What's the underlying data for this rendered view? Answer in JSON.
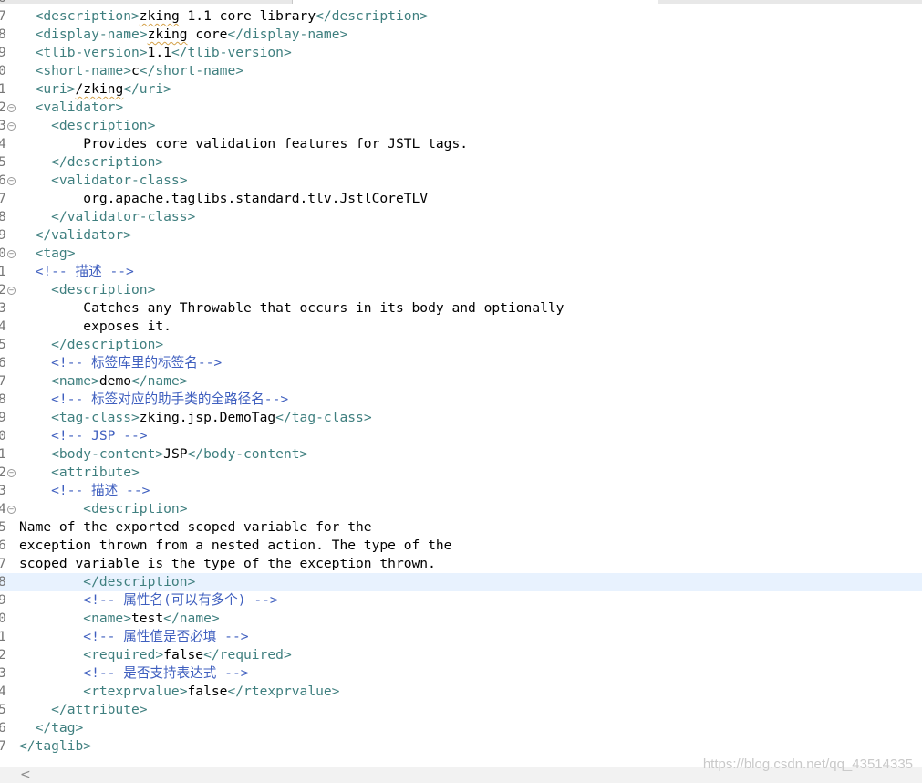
{
  "editor": {
    "current_line": 32,
    "lines": [
      {
        "num": "6",
        "fold": false,
        "segs": []
      },
      {
        "num": "7",
        "fold": false,
        "segs": [
          {
            "t": "  <description>",
            "c": "tag"
          },
          {
            "t": "zking",
            "c": "txt",
            "sq": true
          },
          {
            "t": " 1.1 core library",
            "c": "txt"
          },
          {
            "t": "</description>",
            "c": "tag"
          }
        ]
      },
      {
        "num": "8",
        "fold": false,
        "segs": [
          {
            "t": "  <display-name>",
            "c": "tag"
          },
          {
            "t": "zking",
            "c": "txt",
            "sq": true
          },
          {
            "t": " core",
            "c": "txt"
          },
          {
            "t": "</display-name>",
            "c": "tag"
          }
        ]
      },
      {
        "num": "9",
        "fold": false,
        "segs": [
          {
            "t": "  <tlib-version>",
            "c": "tag"
          },
          {
            "t": "1.1",
            "c": "txt"
          },
          {
            "t": "</tlib-version>",
            "c": "tag"
          }
        ]
      },
      {
        "num": "0",
        "fold": false,
        "segs": [
          {
            "t": "  <short-name>",
            "c": "tag"
          },
          {
            "t": "c",
            "c": "txt"
          },
          {
            "t": "</short-name>",
            "c": "tag"
          }
        ]
      },
      {
        "num": "1",
        "fold": false,
        "segs": [
          {
            "t": "  <uri>",
            "c": "tag"
          },
          {
            "t": "/zking",
            "c": "txt",
            "sq": true
          },
          {
            "t": "</uri>",
            "c": "tag"
          }
        ]
      },
      {
        "num": "2",
        "fold": true,
        "segs": [
          {
            "t": "  <validator>",
            "c": "tag"
          }
        ]
      },
      {
        "num": "3",
        "fold": true,
        "segs": [
          {
            "t": "    <description>",
            "c": "tag"
          }
        ]
      },
      {
        "num": "4",
        "fold": false,
        "segs": [
          {
            "t": "        Provides core validation features for JSTL tags.",
            "c": "txt"
          }
        ]
      },
      {
        "num": "5",
        "fold": false,
        "segs": [
          {
            "t": "    </description>",
            "c": "tag"
          }
        ]
      },
      {
        "num": "6",
        "fold": true,
        "segs": [
          {
            "t": "    <validator-class>",
            "c": "tag"
          }
        ]
      },
      {
        "num": "7",
        "fold": false,
        "segs": [
          {
            "t": "        org.apache.taglibs.standard.tlv.JstlCoreTLV",
            "c": "txt"
          }
        ]
      },
      {
        "num": "8",
        "fold": false,
        "segs": [
          {
            "t": "    </validator-class>",
            "c": "tag"
          }
        ]
      },
      {
        "num": "9",
        "fold": false,
        "segs": [
          {
            "t": "  </validator>",
            "c": "tag"
          }
        ]
      },
      {
        "num": "0",
        "fold": true,
        "segs": [
          {
            "t": "  <tag>",
            "c": "tag"
          }
        ]
      },
      {
        "num": "1",
        "fold": false,
        "segs": [
          {
            "t": "  <!-- 描述 -->",
            "c": "cmt"
          }
        ]
      },
      {
        "num": "2",
        "fold": true,
        "segs": [
          {
            "t": "    <description>",
            "c": "tag"
          }
        ]
      },
      {
        "num": "3",
        "fold": false,
        "segs": [
          {
            "t": "        Catches any Throwable that occurs in its body and optionally",
            "c": "txt"
          }
        ]
      },
      {
        "num": "4",
        "fold": false,
        "segs": [
          {
            "t": "        exposes it.",
            "c": "txt"
          }
        ]
      },
      {
        "num": "5",
        "fold": false,
        "segs": [
          {
            "t": "    </description>",
            "c": "tag"
          }
        ]
      },
      {
        "num": "6",
        "fold": false,
        "segs": [
          {
            "t": "    <!-- 标签库里的标签名-->",
            "c": "cmt"
          }
        ]
      },
      {
        "num": "7",
        "fold": false,
        "segs": [
          {
            "t": "    <name>",
            "c": "tag"
          },
          {
            "t": "demo",
            "c": "txt"
          },
          {
            "t": "</name>",
            "c": "tag"
          }
        ]
      },
      {
        "num": "8",
        "fold": false,
        "segs": [
          {
            "t": "    <!-- 标签对应的助手类的全路径名-->",
            "c": "cmt"
          }
        ]
      },
      {
        "num": "9",
        "fold": false,
        "segs": [
          {
            "t": "    <tag-class>",
            "c": "tag"
          },
          {
            "t": "zking.jsp.DemoTag",
            "c": "txt"
          },
          {
            "t": "</tag-class>",
            "c": "tag"
          }
        ]
      },
      {
        "num": "0",
        "fold": false,
        "segs": [
          {
            "t": "    <!-- JSP -->",
            "c": "cmt"
          }
        ]
      },
      {
        "num": "1",
        "fold": false,
        "segs": [
          {
            "t": "    <body-content>",
            "c": "tag"
          },
          {
            "t": "JSP",
            "c": "txt"
          },
          {
            "t": "</body-content>",
            "c": "tag"
          }
        ]
      },
      {
        "num": "2",
        "fold": true,
        "segs": [
          {
            "t": "    <attribute>",
            "c": "tag"
          }
        ]
      },
      {
        "num": "3",
        "fold": false,
        "segs": [
          {
            "t": "    <!-- 描述 -->",
            "c": "cmt"
          }
        ]
      },
      {
        "num": "4",
        "fold": true,
        "segs": [
          {
            "t": "        <description>",
            "c": "tag"
          }
        ]
      },
      {
        "num": "5",
        "fold": false,
        "segs": [
          {
            "t": "Name of the exported scoped variable for the",
            "c": "txt"
          }
        ]
      },
      {
        "num": "6",
        "fold": false,
        "segs": [
          {
            "t": "exception thrown from a nested action. The type of the",
            "c": "txt"
          }
        ]
      },
      {
        "num": "7",
        "fold": false,
        "segs": [
          {
            "t": "scoped variable is the type of the exception thrown.",
            "c": "txt"
          }
        ]
      },
      {
        "num": "8",
        "fold": false,
        "segs": [
          {
            "t": "        </description>",
            "c": "tag"
          }
        ]
      },
      {
        "num": "9",
        "fold": false,
        "segs": [
          {
            "t": "        <!-- 属性名(可以有多个) -->",
            "c": "cmt"
          }
        ]
      },
      {
        "num": "0",
        "fold": false,
        "segs": [
          {
            "t": "        <name>",
            "c": "tag"
          },
          {
            "t": "test",
            "c": "txt"
          },
          {
            "t": "</name>",
            "c": "tag"
          }
        ]
      },
      {
        "num": "1",
        "fold": false,
        "segs": [
          {
            "t": "        <!-- 属性值是否必填 -->",
            "c": "cmt"
          }
        ]
      },
      {
        "num": "2",
        "fold": false,
        "segs": [
          {
            "t": "        <required>",
            "c": "tag"
          },
          {
            "t": "false",
            "c": "txt"
          },
          {
            "t": "</required>",
            "c": "tag"
          }
        ]
      },
      {
        "num": "3",
        "fold": false,
        "segs": [
          {
            "t": "        <!-- 是否支持表达式 -->",
            "c": "cmt"
          }
        ]
      },
      {
        "num": "4",
        "fold": false,
        "segs": [
          {
            "t": "        <rtexprvalue>",
            "c": "tag"
          },
          {
            "t": "false",
            "c": "txt"
          },
          {
            "t": "</rtexprvalue>",
            "c": "tag"
          }
        ]
      },
      {
        "num": "5",
        "fold": false,
        "segs": [
          {
            "t": "    </attribute>",
            "c": "tag"
          }
        ]
      },
      {
        "num": "6",
        "fold": false,
        "segs": [
          {
            "t": "  </tag>",
            "c": "tag"
          }
        ]
      },
      {
        "num": "7",
        "fold": false,
        "segs": [
          {
            "t": "</taglib>",
            "c": "tag"
          }
        ]
      }
    ]
  },
  "scrollbar": {
    "left_arrow": "<"
  },
  "watermark": "https://blog.csdn.net/qq_43514335",
  "icons": {
    "fold": "collapse-fold-icon",
    "scroll": "scroll-left-arrow-icon"
  },
  "colors": {
    "tag": "#3f7f7f",
    "comment": "#3f5fbf",
    "text": "#000000",
    "current_line": "#e8f2fe",
    "line_number": "#787878"
  }
}
